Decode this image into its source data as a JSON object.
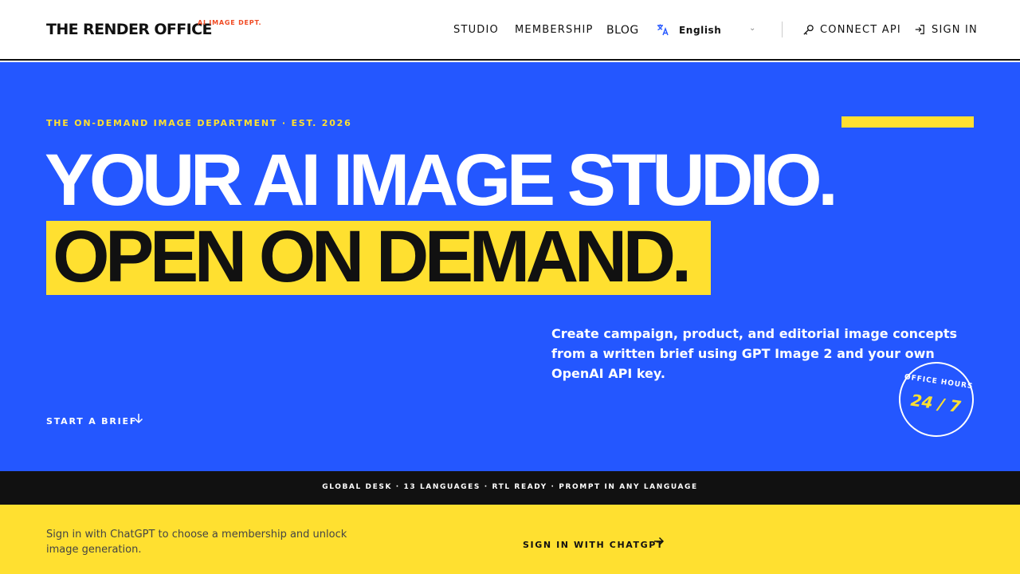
{
  "header": {
    "brand": "THE RENDER OFFICE",
    "brand_tag": "AI IMAGE DEPT.",
    "nav": {
      "studio": "STUDIO",
      "membership": "MEMBERSHIP",
      "blog": "BLOG"
    },
    "language": {
      "selected": "English",
      "icon": "translate-icon"
    },
    "connect_api": "CONNECT API",
    "sign_in": "SIGN IN"
  },
  "hero": {
    "eyebrow": "THE ON-DEMAND IMAGE DEPARTMENT · EST. 2026",
    "headline_line1": "YOUR AI IMAGE STUDIO.",
    "headline_line2": "OPEN ON DEMAND.",
    "subcopy": "Create campaign, product, and editorial image concepts from a written brief using GPT Image 2 and your own OpenAI API key.",
    "cta": "START A BRIEF",
    "badge": {
      "top": "OFFICE HOURS",
      "value": "24 / 7"
    }
  },
  "ticker": {
    "text": "GLOBAL DESK · 13 LANGUAGES · RTL READY · PROMPT IN ANY LANGUAGE"
  },
  "footer": {
    "message": "Sign in with ChatGPT to choose a membership and unlock image generation.",
    "sign_in_chatgpt": "SIGN IN WITH CHATGPT"
  },
  "colors": {
    "hero_blue": "#2457ff",
    "accent_yellow": "#ffe030",
    "tag_orange": "#f04a23",
    "ink": "#111111"
  }
}
